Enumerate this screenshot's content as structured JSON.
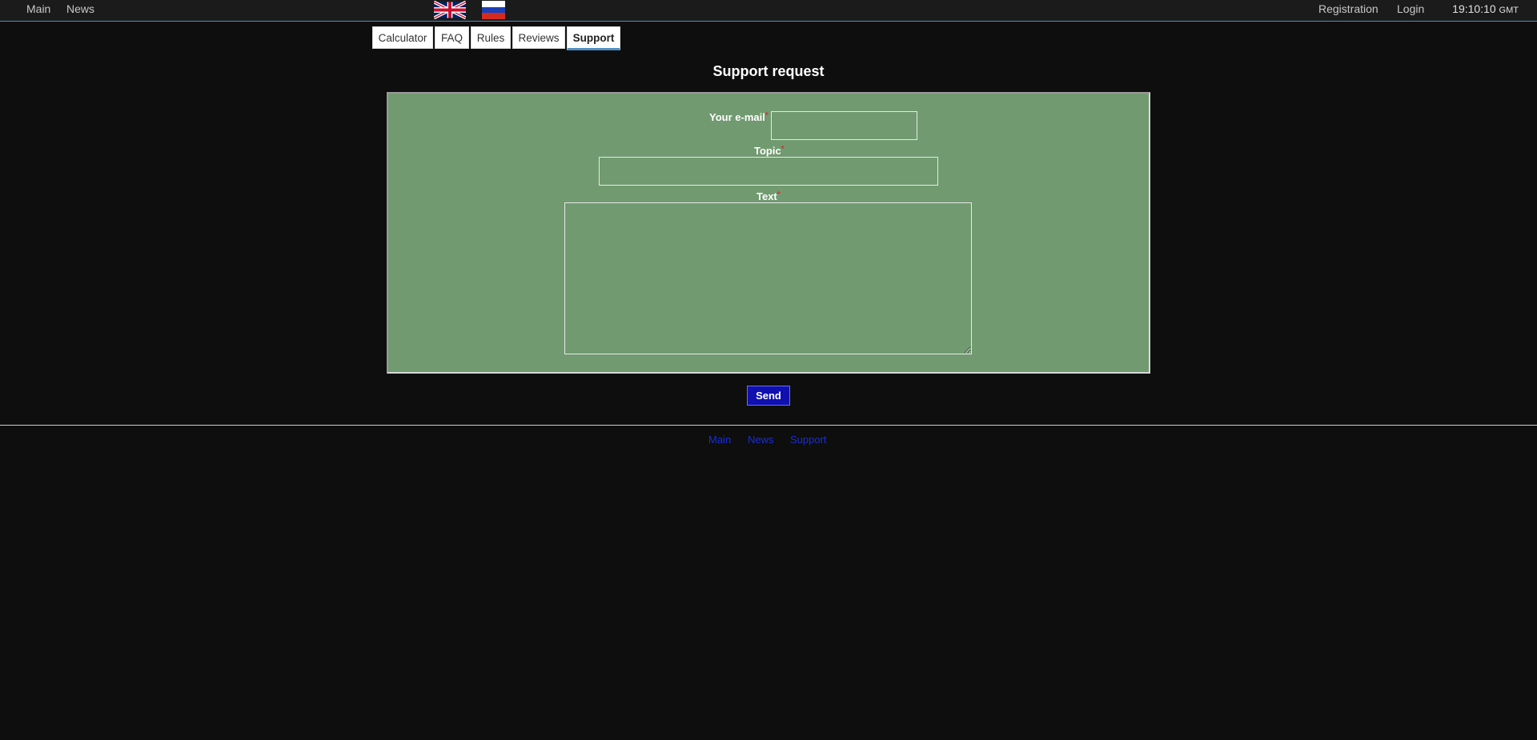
{
  "topbar": {
    "main_label": "Main",
    "news_label": "News",
    "registration_label": "Registration",
    "login_label": "Login",
    "clock_time": "19:10:10",
    "clock_zone": "GMT",
    "flags": [
      "english-flag-icon",
      "russian-flag-icon"
    ]
  },
  "tabs": [
    {
      "label": "Calculator"
    },
    {
      "label": "FAQ"
    },
    {
      "label": "Rules"
    },
    {
      "label": "Reviews"
    },
    {
      "label": "Support",
      "active": true
    }
  ],
  "page": {
    "title": "Support request"
  },
  "form": {
    "email_label": "Your e-mail",
    "email_value": "",
    "topic_label": "Topic",
    "topic_value": "",
    "text_label": "Text",
    "text_value": "",
    "required_marker": "*",
    "send_label": "Send",
    "background_color": "#719a70"
  },
  "footer": {
    "links": [
      "Main",
      "News",
      "Support"
    ]
  },
  "colors": {
    "page_bg": "#0e0e0e",
    "accent": "#4e8fc0",
    "send_button": "#1010b0",
    "footer_link": "#1a2dd8"
  }
}
